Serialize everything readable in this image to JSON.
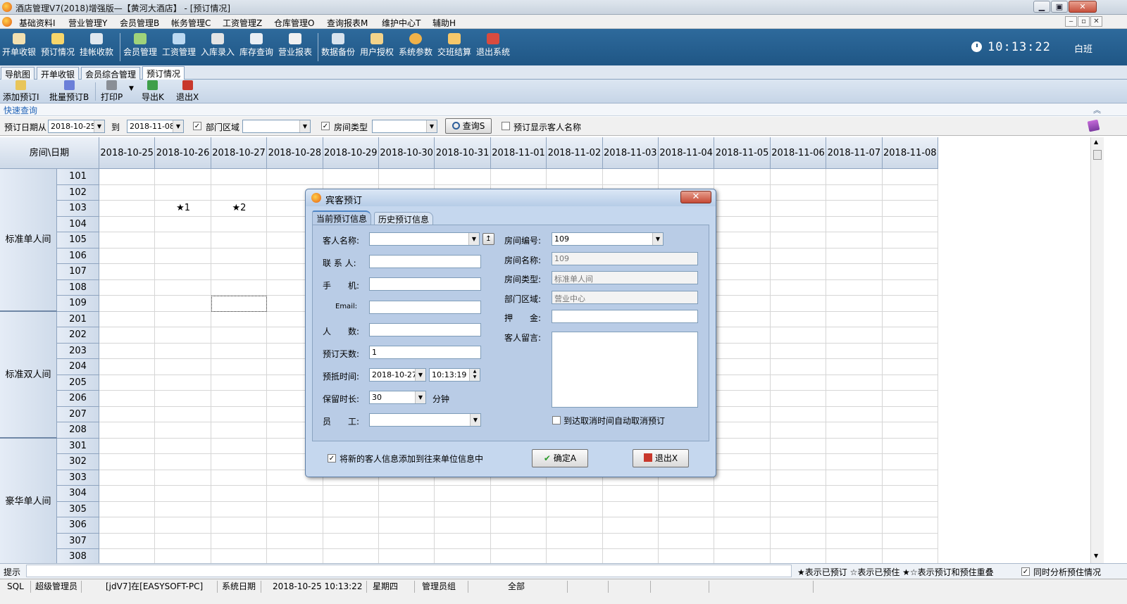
{
  "titlebar": {
    "title": "酒店管理V7(2018)增强版—【黄河大酒店】 - [预订情况]",
    "min": "▁",
    "max": "▣",
    "close": "✕"
  },
  "menubar": {
    "items": [
      "基础资料I",
      "营业管理Y",
      "会员管理B",
      "帐务管理C",
      "工资管理Z",
      "仓库管理O",
      "查询报表M",
      "维护中心T",
      "辅助H"
    ],
    "mdi_min": "‒",
    "mdi_restore": "▫",
    "mdi_close": "✕"
  },
  "toolbar": {
    "buttons": [
      "开单收银",
      "预订情况",
      "挂帐收款",
      "会员管理",
      "工资管理",
      "入库录入",
      "库存查询",
      "营业报表",
      "数据备份",
      "用户授权",
      "系统参数",
      "交班结算",
      "退出系统"
    ],
    "clock": "10:13:22",
    "shift": "白班"
  },
  "tabs": [
    "导航图",
    "开单收银",
    "会员综合管理",
    "预订情况"
  ],
  "subtoolbar": {
    "buttons": [
      "添加预订I",
      "批量预订B",
      "打印P",
      "导出K",
      "退出X"
    ]
  },
  "quick_query": {
    "label": "快速查询",
    "collapse": "︽"
  },
  "filter": {
    "date_from_label": "预订日期从",
    "date_from": "2018-10-25",
    "to_label": "到",
    "date_to": "2018-11-08",
    "dept_label": "部门区域",
    "dept_value": "",
    "roomtype_label": "房间类型",
    "roomtype_value": "",
    "query_button": "查询S",
    "show_guest_label": "预订显示客人名称"
  },
  "grid": {
    "corner": "房间\\日期",
    "dates": [
      "2018-10-25",
      "2018-10-26",
      "2018-10-27",
      "2018-10-28",
      "2018-10-29",
      "2018-10-30",
      "2018-10-31",
      "2018-11-01",
      "2018-11-02",
      "2018-11-03",
      "2018-11-04",
      "2018-11-05",
      "2018-11-06",
      "2018-11-07",
      "2018-11-08"
    ],
    "groups": [
      {
        "name": "标准单人间",
        "rooms": [
          "101",
          "102",
          "103",
          "104",
          "105",
          "106",
          "107",
          "108",
          "109"
        ]
      },
      {
        "name": "标准双人间",
        "rooms": [
          "201",
          "202",
          "203",
          "204",
          "205",
          "206",
          "207",
          "208"
        ]
      },
      {
        "name": "豪华单人间",
        "rooms": [
          "301",
          "302",
          "303",
          "304",
          "305",
          "306",
          "307",
          "308"
        ]
      }
    ],
    "marks": [
      {
        "room": "103",
        "date": "2018-10-26",
        "text": "★1"
      },
      {
        "room": "103",
        "date": "2018-10-27",
        "text": "★2"
      }
    ]
  },
  "dialog": {
    "title": "宾客预订",
    "close": "✕",
    "tabs": [
      "当前预订信息",
      "历史预订信息"
    ],
    "labels": {
      "guest_name": "客人名称:",
      "contact": "联 系 人:",
      "mobile": "手　　机:",
      "email": "Email:",
      "people": "人　　数:",
      "days": "预订天数:",
      "arrive": "预抵时间:",
      "keep": "保留时长:",
      "minutes": "分钟",
      "staff": "员　　工:",
      "room_no": "房间编号:",
      "room_name": "房间名称:",
      "room_type": "房间类型:",
      "dept": "部门区域:",
      "deposit": "押　　金:",
      "message": "客人留言:",
      "auto_cancel": "到达取消时间自动取消预订",
      "add_to_units": "将新的客人信息添加到往来单位信息中"
    },
    "values": {
      "guest_name": "",
      "contact": "",
      "mobile": "",
      "email": "",
      "people": "",
      "days": "1",
      "arrive_date": "2018-10-27",
      "arrive_time": "10:13:19",
      "keep": "30",
      "staff": "",
      "room_no": "109",
      "room_name": "109",
      "room_type": "标准单人间",
      "dept": "营业中心",
      "deposit": "",
      "message": ""
    },
    "ok_button": "确定A",
    "exit_button": "退出X"
  },
  "status": {
    "hint_label": "提示",
    "legend": "★表示已预订 ☆表示已预住 ★☆表示预订和预住重叠",
    "analyze_label": "同时分析预住情况"
  },
  "bottom": {
    "cells": [
      "SQL",
      "超级管理员",
      "[jdV7]在[EASYSOFT-PC]",
      "系统日期",
      "2018-10-25  10:13:22",
      "星期四",
      "管理员组",
      "全部"
    ]
  },
  "colors": {
    "toolbar_bg": "#1f5685",
    "dialog_bg": "#c5d7ee",
    "accent": "#2566b8"
  }
}
